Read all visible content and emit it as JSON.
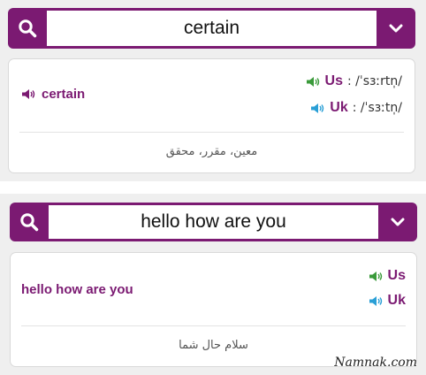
{
  "panels": [
    {
      "query": "certain",
      "word": "certain",
      "us": {
        "label": "Us",
        "ipa": ": /ˈsɜːrtn̩/"
      },
      "uk": {
        "label": "Uk",
        "ipa": ": /ˈsɜːtn̩/"
      },
      "translation": "معین، مقرر، محقق"
    },
    {
      "query": "hello how are you",
      "word": "hello how are you",
      "us": {
        "label": "Us",
        "ipa": ""
      },
      "uk": {
        "label": "Uk",
        "ipa": ""
      },
      "translation": "سلام حال شما"
    }
  ],
  "watermark": "Namnak.com",
  "colors": {
    "brand": "#7b1a72",
    "us_speaker": "#3a9a3a",
    "uk_speaker": "#2a9fd6",
    "word_speaker": "#7b1a72"
  },
  "icons": {
    "search": "search-icon",
    "dropdown": "chevron-down-icon",
    "speaker": "speaker-icon"
  }
}
